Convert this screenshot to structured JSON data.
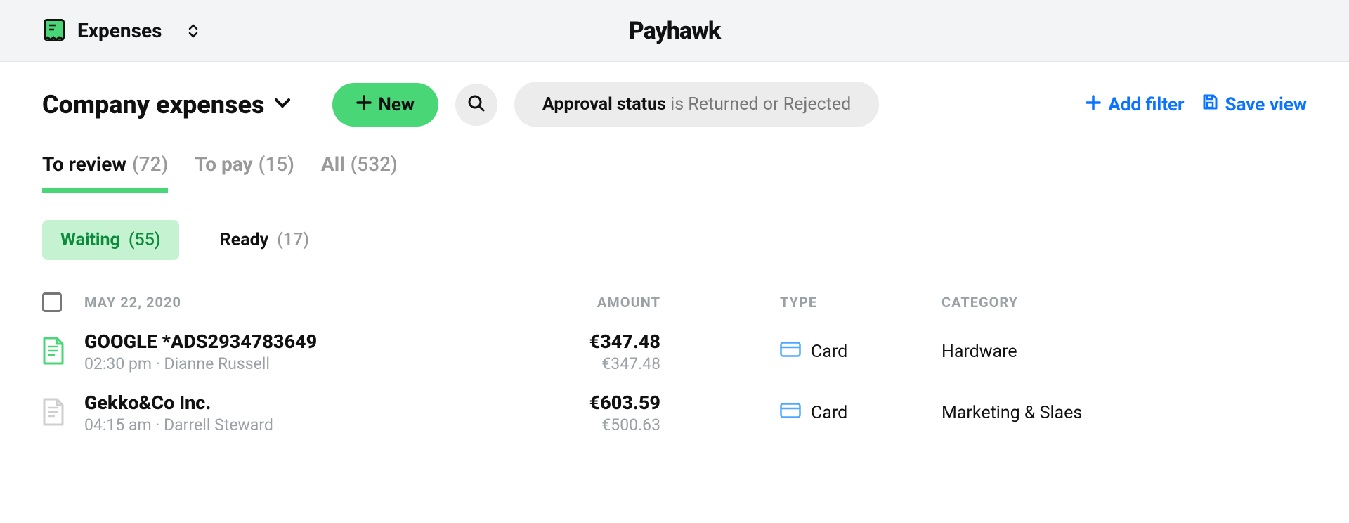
{
  "topbar": {
    "app_name": "Expenses",
    "brand": "Payhawk"
  },
  "header": {
    "page_title": "Company expenses",
    "new_label": "New",
    "filter_label": "Approval status",
    "filter_value": "is Returned or Rejected",
    "add_filter": "Add filter",
    "save_view": "Save view"
  },
  "tabs": [
    {
      "label": "To review",
      "count": "(72)",
      "active": true
    },
    {
      "label": "To pay",
      "count": "(15)",
      "active": false
    },
    {
      "label": "All",
      "count": "(532)",
      "active": false
    }
  ],
  "subtabs": [
    {
      "label": "Waiting",
      "count": "(55)",
      "active": true
    },
    {
      "label": "Ready",
      "count": "(17)",
      "active": false
    }
  ],
  "table": {
    "date_group": "MAY 22, 2020",
    "col_amount": "AMOUNT",
    "col_type": "TYPE",
    "col_category": "CATEGORY",
    "rows": [
      {
        "title": "GOOGLE *ADS2934783649",
        "sub": "02:30 pm · Dianne Russell",
        "amount_primary": "€347.48",
        "amount_secondary": "€347.48",
        "type": "Card",
        "category": "Hardware",
        "icon_color": "#49d677"
      },
      {
        "title": "Gekko&Co Inc.",
        "sub": "04:15 am · Darrell Steward",
        "amount_primary": "€603.59",
        "amount_secondary": "€500.63",
        "type": "Card",
        "category": "Marketing & Slaes",
        "icon_color": "#cfcfcf"
      }
    ]
  }
}
